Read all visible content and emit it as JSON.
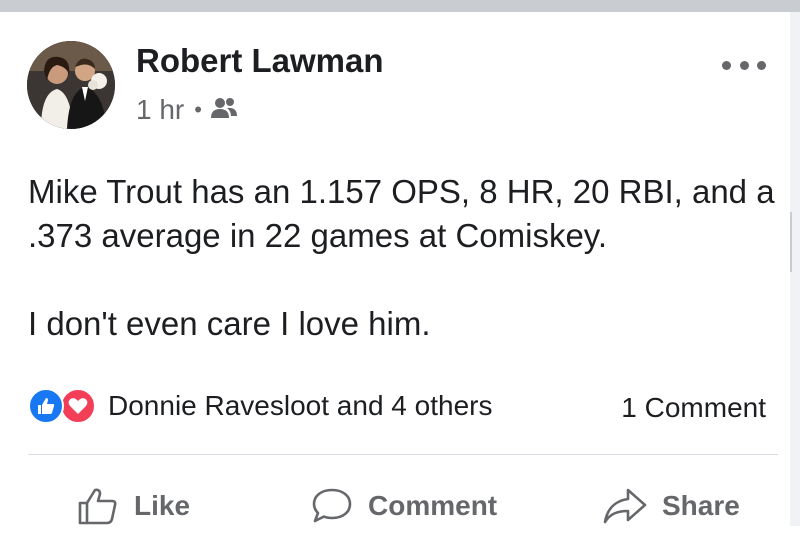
{
  "post": {
    "author": "Robert Lawman",
    "time": "1 hr",
    "separator": "•",
    "audience_icon": "friends-icon",
    "body": [
      "Mike Trout has an 1.157 OPS, 8 HR, 20 RBI, and a .373 average in 22 games at Comiskey.",
      "I don't even care I love him."
    ]
  },
  "reactions": {
    "summary": "Donnie Ravesloot and 4 others",
    "icons": [
      "like-reaction-icon",
      "love-reaction-icon"
    ],
    "comments": "1 Comment"
  },
  "actions": {
    "like": "Like",
    "comment": "Comment",
    "share": "Share"
  },
  "colors": {
    "like_blue": "#1877f2",
    "love_red": "#f33e58",
    "muted_text": "#65676b"
  }
}
